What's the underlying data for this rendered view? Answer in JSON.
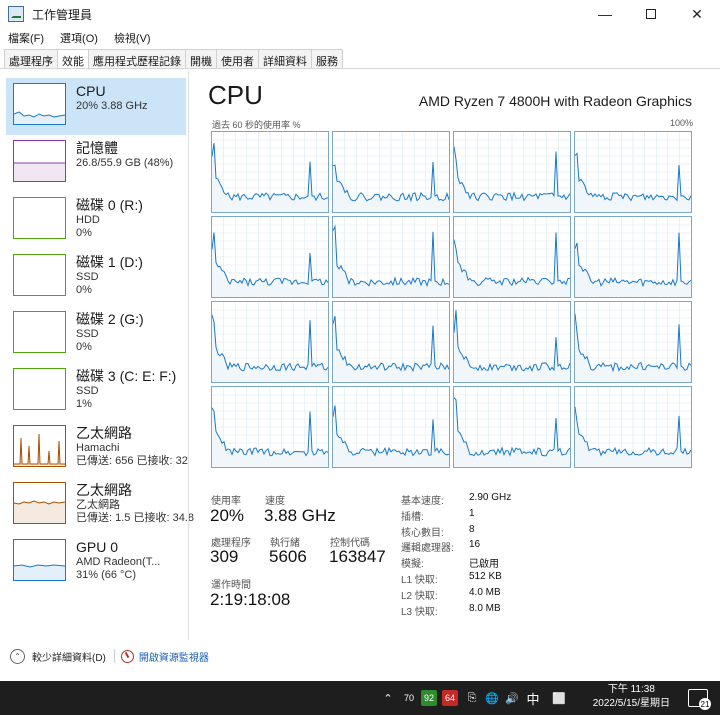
{
  "window": {
    "title": "工作管理員",
    "min_icon": "minimize-icon",
    "max_icon": "maximize-icon",
    "close_icon": "close-icon"
  },
  "menu": [
    "檔案(F)",
    "選項(O)",
    "檢視(V)"
  ],
  "tabs": [
    "處理程序",
    "效能",
    "應用程式歷程記錄",
    "開機",
    "使用者",
    "詳細資料",
    "服務"
  ],
  "active_tab": 1,
  "sidebar": [
    {
      "title": "CPU",
      "line1": "20%  3.88 GHz",
      "line2": "",
      "color": "#1979ca",
      "selected": true
    },
    {
      "title": "記憶體",
      "line1": "26.8/55.9 GB (48%)",
      "line2": "",
      "color": "#8b3b9f"
    },
    {
      "title": "磁碟 0 (R:)",
      "line1": "HDD",
      "line2": "0%",
      "color": "#4da60c"
    },
    {
      "title": "磁碟 1 (D:)",
      "line1": "SSD",
      "line2": "0%",
      "color": "#4da60c"
    },
    {
      "title": "磁碟 2 (G:)",
      "line1": "SSD",
      "line2": "0%",
      "color": "#4da60c"
    },
    {
      "title": "磁碟 3 (C: E: F:)",
      "line1": "SSD",
      "line2": "1%",
      "color": "#4da60c"
    },
    {
      "title": "乙太網路",
      "line1": "Hamachi",
      "line2": "已傳送: 656 已接收: 32",
      "color": "#a74f01"
    },
    {
      "title": "乙太網路",
      "line1": "乙太網路",
      "line2": "已傳送: 1.5 已接收: 34.8",
      "color": "#a74f01"
    },
    {
      "title": "GPU 0",
      "line1": "AMD Radeon(T...",
      "line2": "31% (66 °C)",
      "color": "#1979ca"
    }
  ],
  "main": {
    "heading": "CPU",
    "model": "AMD Ryzen 7 4800H with Radeon Graphics",
    "graph_caption_left": "過去 60 秒的使用率 %",
    "graph_caption_right": "100%",
    "graph_color": "#1979ca",
    "graph_fill": "#f1f6fb"
  },
  "stats": {
    "util_label": "使用率",
    "util_value": "20%",
    "speed_label": "速度",
    "speed_value": "3.88 GHz",
    "proc_label": "處理程序",
    "proc_value": "309",
    "threads_label": "執行緒",
    "threads_value": "5606",
    "handles_label": "控制代碼",
    "handles_value": "163847",
    "uptime_label": "運作時間",
    "uptime_value": "2:19:18:08"
  },
  "specs": [
    {
      "label": "基本速度:",
      "value": "2.90 GHz"
    },
    {
      "label": "插槽:",
      "value": "1"
    },
    {
      "label": "核心數目:",
      "value": "8"
    },
    {
      "label": "邏輯處理器:",
      "value": "16"
    },
    {
      "label": "模擬:",
      "value": "已啟用"
    },
    {
      "label": "L1 快取:",
      "value": "512 KB"
    },
    {
      "label": "L2 快取:",
      "value": "4.0 MB"
    },
    {
      "label": "L3 快取:",
      "value": "8.0 MB"
    }
  ],
  "footer": {
    "fewer_details": "較少詳細資料(D)",
    "resource_monitor": "開啟資源監視器"
  },
  "taskbar": {
    "tray_badges": [
      {
        "text": "70",
        "bg": "#1e1e1e"
      },
      {
        "text": "92",
        "bg": "#2e8b2e"
      },
      {
        "text": "64",
        "bg": "#c62828"
      }
    ],
    "ime": "中",
    "time": "下午 11:38",
    "date": "2022/5/15/星期日",
    "notification_count": "21"
  }
}
